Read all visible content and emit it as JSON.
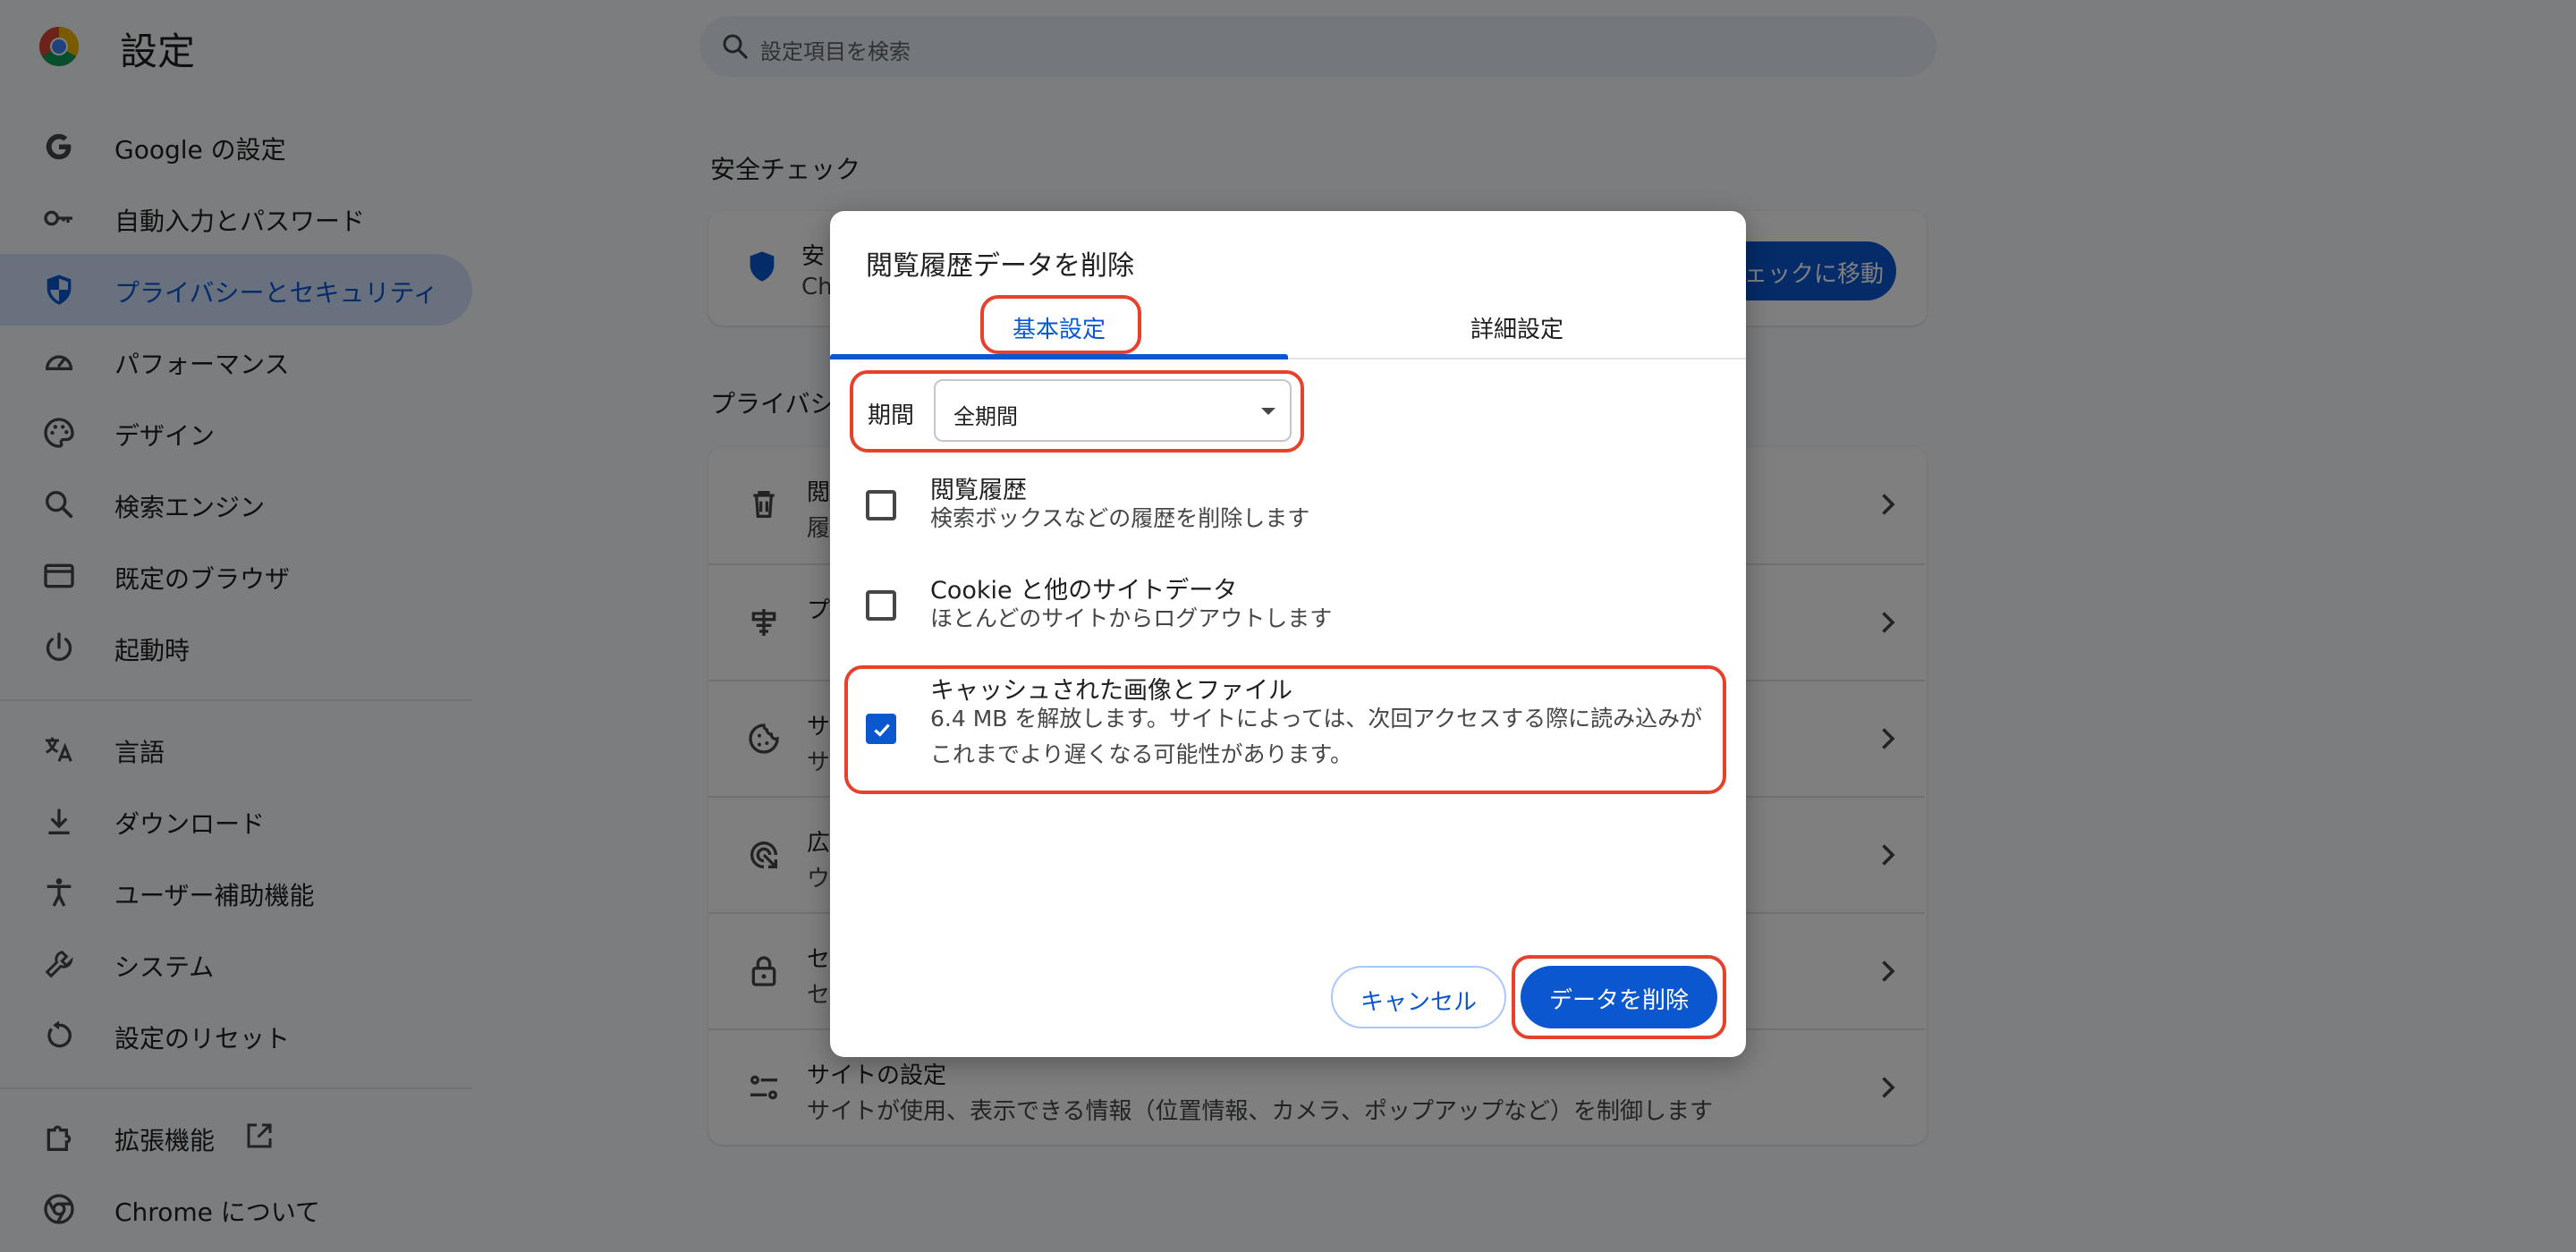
{
  "header": {
    "title": "設定",
    "search_placeholder": "設定項目を検索"
  },
  "sidebar": {
    "items": [
      {
        "label": "Google の設定",
        "icon": "google-g-icon"
      },
      {
        "label": "自動入力とパスワード",
        "icon": "key-icon"
      },
      {
        "label": "プライバシーとセキュリティ",
        "icon": "shield-icon",
        "active": true
      },
      {
        "label": "パフォーマンス",
        "icon": "speedometer-icon"
      },
      {
        "label": "デザイン",
        "icon": "palette-icon"
      },
      {
        "label": "検索エンジン",
        "icon": "search-icon"
      },
      {
        "label": "既定のブラウザ",
        "icon": "browser-window-icon"
      },
      {
        "label": "起動時",
        "icon": "power-icon"
      },
      {
        "label": "言語",
        "icon": "translate-icon"
      },
      {
        "label": "ダウンロード",
        "icon": "download-icon"
      },
      {
        "label": "ユーザー補助機能",
        "icon": "accessibility-icon"
      },
      {
        "label": "システム",
        "icon": "wrench-icon"
      },
      {
        "label": "設定のリセット",
        "icon": "reset-icon"
      },
      {
        "label": "拡張機能",
        "icon": "puzzle-icon"
      },
      {
        "label": "Chrome について",
        "icon": "chrome-icon"
      }
    ]
  },
  "main": {
    "safety_section_title": "安全チェック",
    "safety_card_title_partial": "安",
    "safety_card_sub_partial": "Ch",
    "safety_button_partial": "ェックに移動",
    "privacy_section_title_partial": "プライバシ",
    "rows": [
      {
        "title": "閲",
        "sub": "履",
        "icon": "trash-icon"
      },
      {
        "title": "プ",
        "sub": "",
        "icon": "ad-privacy-icon"
      },
      {
        "title": "サ",
        "sub": "サ",
        "icon": "cookie-icon"
      },
      {
        "title": "広",
        "sub": "ウ",
        "icon": "ad-target-icon"
      },
      {
        "title": "セ",
        "sub": "セ",
        "icon": "lock-icon"
      },
      {
        "title": "サイトの設定",
        "sub": "サイトが使用、表示できる情報（位置情報、カメラ、ポップアップなど）を制御します",
        "icon": "sliders-icon"
      }
    ]
  },
  "dialog": {
    "title": "閲覧履歴データを削除",
    "tabs": [
      {
        "label": "基本設定",
        "active": true
      },
      {
        "label": "詳細設定",
        "active": false
      }
    ],
    "period_label": "期間",
    "period_value": "全期間",
    "options": [
      {
        "title": "閲覧履歴",
        "desc": "検索ボックスなどの履歴を削除します",
        "checked": false
      },
      {
        "title": "Cookie と他のサイトデータ",
        "desc": "ほとんどのサイトからログアウトします",
        "checked": false
      },
      {
        "title": "キャッシュされた画像とファイル",
        "desc": "6.4 MB を解放します。サイトによっては、次回アクセスする際に読み込みがこれまでより遅くなる可能性があります。",
        "checked": true
      }
    ],
    "cancel_label": "キャンセル",
    "delete_label": "データを削除"
  },
  "colors": {
    "accent": "#0b57d0",
    "highlight": "#e8412b",
    "sidebar_active_bg": "#d3e3fd"
  }
}
